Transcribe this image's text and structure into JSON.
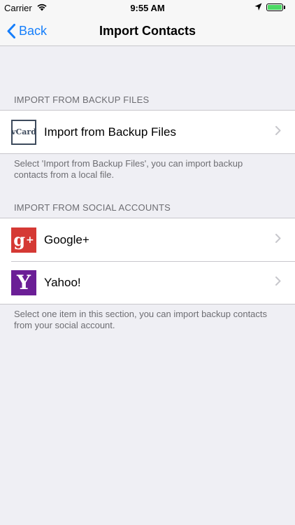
{
  "status_bar": {
    "carrier": "Carrier",
    "time": "9:55 AM",
    "battery_color": "#4cd964"
  },
  "nav": {
    "back_label": "Back",
    "title": "Import Contacts",
    "accent": "#157efb"
  },
  "sections": [
    {
      "header": "IMPORT FROM BACKUP FILES",
      "rows": [
        {
          "icon": "vcard-icon",
          "icon_text": "vCard",
          "label": "Import from Backup Files"
        }
      ],
      "footer": "Select 'Import from Backup Files', you can import backup contacts from a local file."
    },
    {
      "header": "IMPORT FROM SOCIAL ACCOUNTS",
      "rows": [
        {
          "icon": "google-plus-icon",
          "icon_text": "g",
          "icon_sup": "+",
          "label": "Google+"
        },
        {
          "icon": "yahoo-icon",
          "icon_text": "Y",
          "label": "Yahoo!"
        }
      ],
      "footer": "Select one item in this section, you can import backup contacts from your social account."
    }
  ]
}
